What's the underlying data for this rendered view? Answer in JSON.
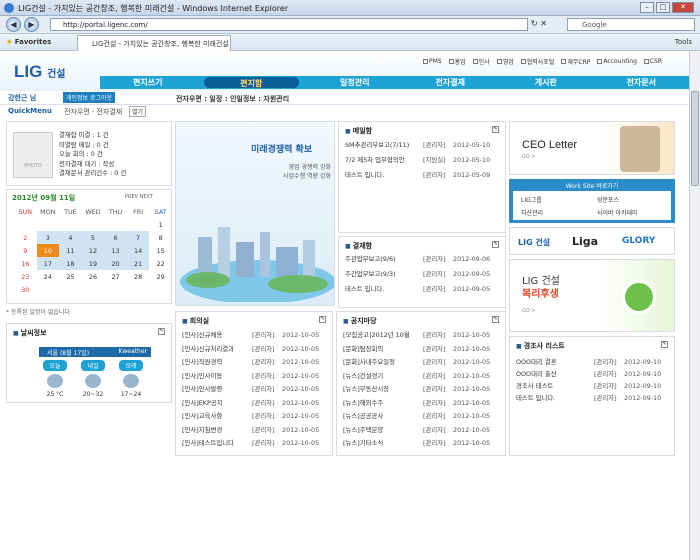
{
  "browser": {
    "title": "LIG건설 - 가치있는 공간창조, 행복한 미래건설 - Windows Internet Explorer",
    "url": "http://portal.ligenc.com/",
    "search_placeholder": "Google",
    "favorites": "Favorites",
    "tab_label": "LIG건설 - 가치있는 공간창조, 행복한 미래건설",
    "tools": "Tools"
  },
  "header": {
    "logo": "LIG",
    "logo_sub": "건설",
    "top_links": [
      "PMS",
      "홍업",
      "인사",
      "영업",
      "협력사포털",
      "재무CRP",
      "Accounting",
      "CSR"
    ],
    "menu": [
      "편지쓰기",
      "편지함",
      "일정관리",
      "전자결재",
      "게시판",
      "전자문서"
    ],
    "active_menu": "편지함"
  },
  "subbar": {
    "user": "강한근 님",
    "logout": "개인정보 로그아웃",
    "status": "전자우편 : 일정 : 인일정보 : 자원관리"
  },
  "quick": {
    "label": "QuickMenu",
    "path": "전자우편 · 전자결재",
    "button": "열기"
  },
  "profile": {
    "photo_label": "PHOTO",
    "stats": [
      "결재함 미결 : 1 건",
      "미열람 메일 : 0 건",
      "오늘 회의 : 0 건",
      "전자결재 대기 : 작성",
      "결재문서 관리건수 : 0 건"
    ]
  },
  "calendar": {
    "month": "2012년 09월 11일",
    "nav": "PREV NEXT",
    "days": [
      "SUN",
      "MON",
      "TUE",
      "WED",
      "THU",
      "FRI",
      "SAT"
    ],
    "weeks": [
      [
        "",
        "",
        "",
        "",
        "",
        "",
        "1"
      ],
      [
        "2",
        "3",
        "4",
        "5",
        "6",
        "7",
        "8"
      ],
      [
        "9",
        "10",
        "11",
        "12",
        "13",
        "14",
        "15"
      ],
      [
        "16",
        "17",
        "18",
        "19",
        "20",
        "21",
        "22"
      ],
      [
        "23",
        "24",
        "25",
        "26",
        "27",
        "28",
        "29"
      ],
      [
        "30",
        "",
        "",
        "",
        "",
        "",
        ""
      ]
    ],
    "today": "10",
    "note": "* 등록된 일정이 없습니다."
  },
  "weather": {
    "title": "날씨정보",
    "city": "서울 (8월 17일)",
    "brand": "Kweather",
    "labels": [
      "오늘",
      "내일",
      "모레"
    ],
    "temps": [
      "25 °C",
      "20~32",
      "17~24"
    ]
  },
  "banner": {
    "title": "미래경쟁력 확보",
    "lines": [
      "영업 경쟁력 강화",
      "사업수행 역량 강화"
    ]
  },
  "notice": {
    "title": "메일함",
    "rows": [
      [
        "SM추관리무보고(7/11)",
        "[관리자]",
        "2012-05-10"
      ],
      [
        "7/2 제5차 업무협의안",
        "[지원실]",
        "2012-05-10"
      ],
      [
        "테스트 입니다.",
        "[관리자]",
        "2012-05-09"
      ]
    ]
  },
  "board2": {
    "title": "결재함",
    "rows": [
      [
        "주관업무보고(9/6)",
        "[관리자]",
        "2012-09-06"
      ],
      [
        "주간업무보고(9/3)",
        "[관리자]",
        "2012-09-05"
      ],
      [
        "테스트 입니다.",
        "[관리자]",
        "2012-09-05"
      ]
    ]
  },
  "ceo": {
    "title": "CEO Letter",
    "go": "GO >"
  },
  "shortcut": {
    "title": "Work Site 바로가기",
    "links": [
      "LIG그룹",
      "성문포스",
      "자산관리",
      "사이버 아카데미"
    ]
  },
  "brands": [
    "LIG 건설",
    "Liga",
    "GLORY"
  ],
  "welfare": {
    "title": "LIG 건설",
    "sub": "복리후생",
    "go": "GO >"
  },
  "events": {
    "title": "경조사 리스트",
    "rows": [
      [
        "OOO대리 결혼",
        "[관리자]",
        "2012-09-10"
      ],
      [
        "OOO대리 출산",
        "[관리자]",
        "2012-09-10"
      ],
      [
        "경조사 테스트",
        "[관리자]",
        "2012-09-10"
      ],
      [
        "테스트 입니다.",
        "[관리자]",
        "2012-09-10"
      ]
    ]
  },
  "board3": {
    "title": "회의실",
    "rows": [
      [
        "[인사]신규채용",
        "[관리자]",
        "2012-10-05"
      ],
      [
        "[인사]신규처리결과",
        "[관리자]",
        "2012-10-05"
      ],
      [
        "[인사]직원경력",
        "[관리자]",
        "2012-10-05"
      ],
      [
        "[인사]인사이동",
        "[관리자]",
        "2012-10-05"
      ],
      [
        "[인사]인사발령",
        "[관리자]",
        "2012-10-05"
      ],
      [
        "[인사]EKP공지",
        "[관리자]",
        "2012-10-05"
      ],
      [
        "[인사]교육사항",
        "[관리자]",
        "2012-10-05"
      ],
      [
        "[인사]지침변경",
        "[관리자]",
        "2012-10-05"
      ],
      [
        "[인사]테스트입니다",
        "[관리자]",
        "2012-10-05"
      ]
    ]
  },
  "board4": {
    "title": "공지마당",
    "rows": [
      [
        "[모집공고]2012년 10월",
        "[관리자]",
        "2012-10-05"
      ],
      [
        "[문화]팀장회의",
        "[관리자]",
        "2012-10-05"
      ],
      [
        "[문화]사내주요일정",
        "[관리자]",
        "2012-10-05"
      ],
      [
        "[뉴스]건설경기",
        "[관리자]",
        "2012-10-05"
      ],
      [
        "[뉴스]부동산시장",
        "[관리자]",
        "2012-10-05"
      ],
      [
        "[뉴스]해외수주",
        "[관리자]",
        "2012-10-05"
      ],
      [
        "[뉴스]공공공사",
        "[관리자]",
        "2012-10-05"
      ],
      [
        "[뉴스]주택분양",
        "[관리자]",
        "2012-10-05"
      ],
      [
        "[뉴스]기타소식",
        "[관리자]",
        "2012-10-05"
      ]
    ]
  }
}
